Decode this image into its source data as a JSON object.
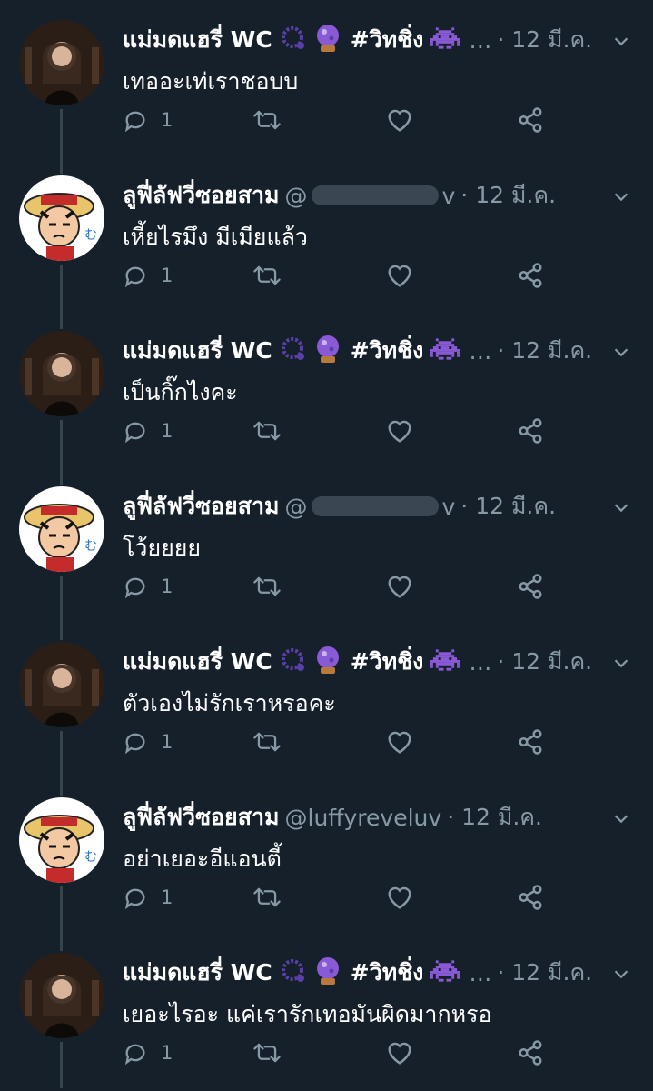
{
  "tweets": [
    {
      "name": "แม่มดแฮรี่ WC",
      "hashtag": "#วิทชิ่ง",
      "handle": "",
      "dots": "…",
      "date": "· 12 มี.ค.",
      "text": "เทออะเท่เราชอบบ",
      "reply_count": "1",
      "author": "witch"
    },
    {
      "name": "ลูฟี่ลัฟวี่ซอยสาม",
      "hashtag": "",
      "handle": "@",
      "handle_tail": "v",
      "dots": "",
      "date": "· 12 มี.ค.",
      "text": "เหี้ยไรมึง มีเมียแล้ว",
      "reply_count": "1",
      "author": "luffy"
    },
    {
      "name": "แม่มดแฮรี่ WC",
      "hashtag": "#วิทชิ่ง",
      "handle": "",
      "dots": "…",
      "date": "· 12 มี.ค.",
      "text": "เป็นกิ๊กไงคะ",
      "reply_count": "1",
      "author": "witch"
    },
    {
      "name": "ลูฟี่ลัฟวี่ซอยสาม",
      "hashtag": "",
      "handle": "@",
      "handle_tail": "v",
      "dots": "",
      "date": "· 12 มี.ค.",
      "text": "โว้ยยยย",
      "reply_count": "1",
      "author": "luffy"
    },
    {
      "name": "แม่มดแฮรี่ WC",
      "hashtag": "#วิทชิ่ง",
      "handle": "",
      "dots": "…",
      "date": "· 12 มี.ค.",
      "text": "ตัวเองไม่รักเราหรอคะ",
      "reply_count": "1",
      "author": "witch"
    },
    {
      "name": "ลูฟี่ลัฟวี่ซอยสาม",
      "hashtag": "",
      "handle": "@luffyreveluv",
      "handle_tail": "",
      "dots": "",
      "date": "· 12 มี.ค.",
      "text": "อย่าเยอะอีแอนตี้",
      "reply_count": "1",
      "author": "luffy"
    },
    {
      "name": "แม่มดแฮรี่ WC",
      "hashtag": "#วิทชิ่ง",
      "handle": "",
      "dots": "…",
      "date": "· 12 มี.ค.",
      "text": "เยอะไรอะ แค่เรารักเทอมันผิดมากหรอ",
      "reply_count": "1",
      "author": "witch"
    }
  ],
  "icons": {
    "reply": "reply-icon",
    "retweet": "retweet-icon",
    "like": "heart-icon",
    "share": "share-icon",
    "caret": "chevron-down-icon"
  },
  "colors": {
    "background": "#15202b",
    "secondary_text": "#8899a6",
    "thread_line": "#38444d",
    "emoji_purple": "#8a5ad6"
  }
}
